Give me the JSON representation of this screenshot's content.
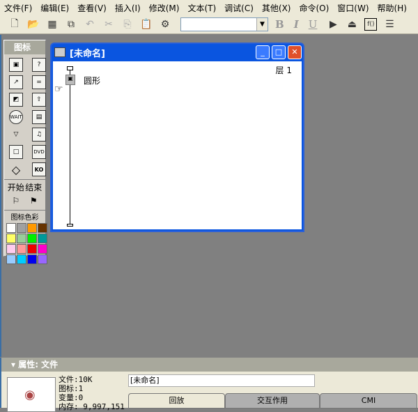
{
  "menu": [
    "文件(F)",
    "编辑(E)",
    "查看(V)",
    "插入(I)",
    "修改(M)",
    "文本(T)",
    "调试(C)",
    "其他(X)",
    "命令(O)",
    "窗口(W)",
    "帮助(H)"
  ],
  "toolbar": {
    "font_value": "",
    "bold": "B",
    "italic": "I",
    "underline": "U"
  },
  "palette": {
    "title": "图标",
    "start": "开始",
    "end": "结束",
    "colors_label": "图标色彩",
    "colors": [
      "#ffffff",
      "#a0a0a0",
      "#ff9900",
      "#663300",
      "#ffff66",
      "#99cc99",
      "#00ee00",
      "#009999",
      "#ffccee",
      "#ff9999",
      "#ee0000",
      "#ff00cc",
      "#99ccff",
      "#00ccff",
      "#0000ee",
      "#9966ff"
    ]
  },
  "design": {
    "title": "[未命名]",
    "level": "层 1",
    "icon_label": "圆形"
  },
  "properties": {
    "title": "属性: 文件",
    "file": "文件:10K",
    "icons": "图标:1",
    "vars": "变量:0",
    "memory": "内存: 9,997,151",
    "name_value": "[未命名]",
    "tabs": [
      "回放",
      "交互作用",
      "CMI"
    ]
  }
}
